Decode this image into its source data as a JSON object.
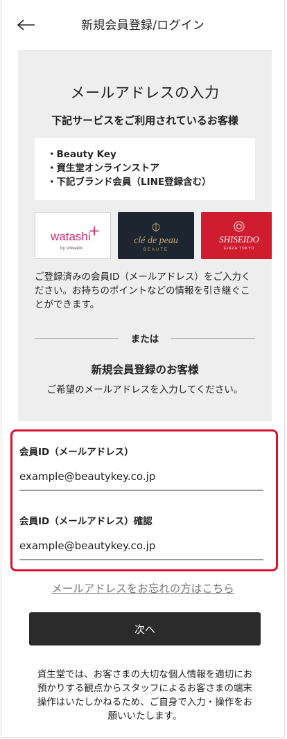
{
  "header": {
    "title": "新規会員登録/ログイン",
    "back_icon": "arrow-left-icon"
  },
  "panel": {
    "title": "メールアドレスの入力",
    "subtitle": "下記サービスをご利用されているお客様",
    "services": [
      "Beauty Key",
      "資生堂オンラインストア",
      "下記ブランド会員（LINE登録含む）"
    ],
    "brands": [
      {
        "name": "watashi",
        "sub": "by shiseido",
        "color": "#d02a6e"
      },
      {
        "name": "clé de peau",
        "sub": "BEAUTÉ",
        "color": "#c8a96b"
      },
      {
        "name": "SHISEIDO",
        "sub": "GINZA TOKYO",
        "color": "#ffffff"
      }
    ],
    "description": "ご登録済みの会員ID（メールアドレス）をご入力ください。お持ちのポイントなどの情報を引き継ぐことができます。",
    "or_label": "または",
    "new_member_title": "新規会員登録のお客様",
    "new_member_text": "ご希望のメールアドレスを入力してください。"
  },
  "form": {
    "email_label": "会員ID（メールアドレス）",
    "email_placeholder": "example@beautykey.co.jp",
    "confirm_label": "会員ID（メールアドレス）確認",
    "confirm_placeholder": "example@beautykey.co.jp"
  },
  "forgot_link": "メールアドレスをお忘れの方はこちら",
  "next_button": "次へ",
  "footer_note": "資生堂では、お客さまの大切な個人情報を適切にお預かりする観点からスタッフによるお客さまの端末操作はいたしかねるため、ご自身で入力・操作をお願いいたします。",
  "colors": {
    "accent_red": "#d8132f",
    "button_dark": "#2b2b2b",
    "panel_bg": "#eeeeee"
  }
}
